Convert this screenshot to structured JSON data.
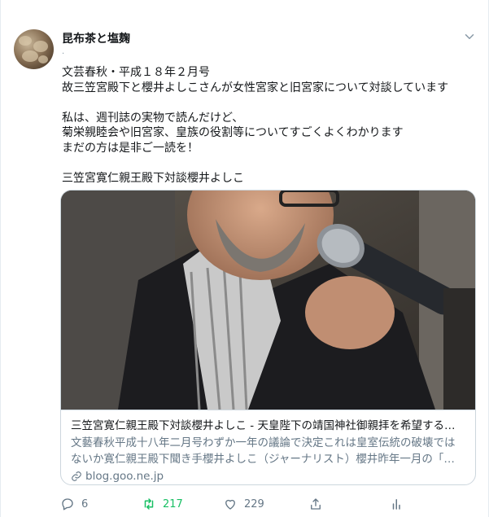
{
  "author": {
    "name": "昆布茶と塩麹",
    "sub": "."
  },
  "tweet": {
    "text": "文芸春秋・平成１８年２月号\n故三笠宮殿下と櫻井よしこさんが女性宮家と旧宮家について対談しています\n\n私は、週刊誌の実物で読んだけど、\n菊栄親睦会や旧宮家、皇族の役割等についてすごくよくわかります\nまだの方は是非ご一読を！\n\n三笠宮寛仁親王殿下対談櫻井よしこ"
  },
  "card": {
    "title": "三笠宮寛仁親王殿下対談櫻井よしこ - 天皇陛下の靖国神社御親拝を希望する…",
    "description": "文藝春秋平成十八年二月号わずか一年の議論で決定これは皇室伝統の破壊ではないか寛仁親王殿下聞き手櫻井よしこ（ジャーナリスト）櫻井昨年一月の「…",
    "domain": "blog.goo.ne.jp"
  },
  "actions": {
    "reply_count": "6",
    "retweet_count": "217",
    "like_count": "229"
  },
  "colors": {
    "retweet": "#17bf63",
    "muted": "#657786",
    "border": "#ccd6dd"
  },
  "icons": [
    "chevron-down-icon",
    "reply-icon",
    "retweet-icon",
    "like-icon",
    "share-icon",
    "analytics-icon",
    "link-icon"
  ]
}
